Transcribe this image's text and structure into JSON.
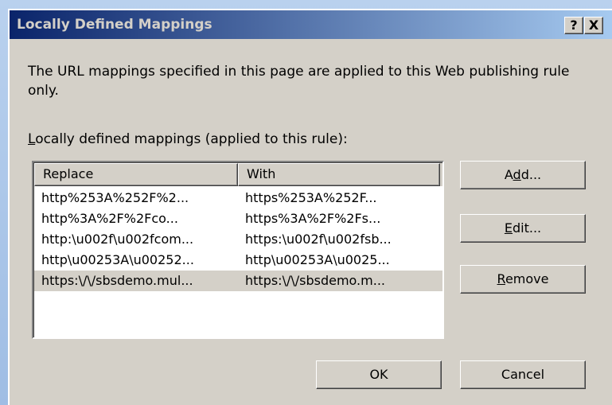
{
  "window": {
    "title": "Locally Defined Mappings",
    "help_glyph": "?",
    "close_glyph": "X"
  },
  "description": "The URL mappings specified in this page are applied to this Web publishing rule only.",
  "list_label": {
    "mnemonic": "L",
    "rest": "ocally defined mappings (applied to this rule):"
  },
  "listview": {
    "columns": [
      "Replace",
      "With"
    ],
    "rows": [
      {
        "replace": "http%253A%252F%2...",
        "with": "https%253A%252F...",
        "selected": false
      },
      {
        "replace": "http%3A%2F%2Fco...",
        "with": "https%3A%2F%2Fs...",
        "selected": false
      },
      {
        "replace": "http:\\u002f\\u002fcom...",
        "with": "https:\\u002f\\u002fsb...",
        "selected": false
      },
      {
        "replace": "http\\u00253A\\u00252...",
        "with": "http\\u00253A\\u0025...",
        "selected": false
      },
      {
        "replace": "https:\\/\\/sbsdemo.mul...",
        "with": "https:\\/\\/sbsdemo.m...",
        "selected": true
      }
    ]
  },
  "buttons": {
    "add": {
      "pre": "A",
      "mnemonic": "d",
      "post": "d..."
    },
    "edit": {
      "pre": "",
      "mnemonic": "E",
      "post": "dit..."
    },
    "remove": {
      "pre": "",
      "mnemonic": "R",
      "post": "emove"
    },
    "ok": "OK",
    "cancel": "Cancel"
  },
  "colors": {
    "title_start": "#0a246a",
    "title_end": "#a6caf0",
    "face": "#d4d0c8",
    "selection": "#d4d0c8"
  }
}
